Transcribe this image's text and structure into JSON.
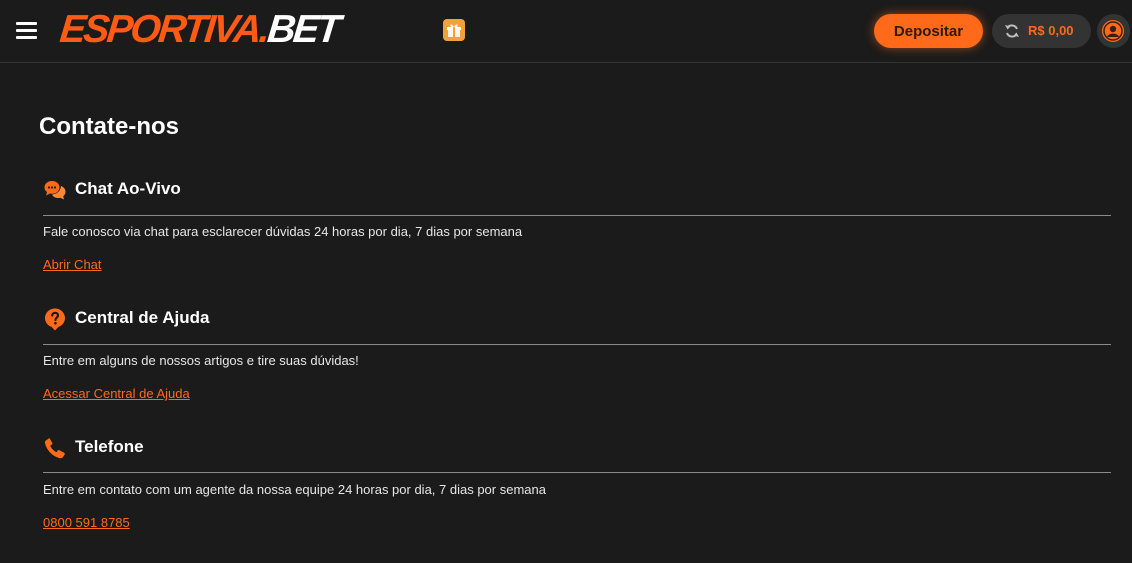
{
  "header": {
    "logo_part1": "ESPORTIVA",
    "logo_dot": ".",
    "logo_part2": "BET",
    "deposit_label": "Depositar",
    "balance": "R$ 0,00",
    "icons": {
      "menu": "hamburger-menu-icon",
      "gift": "gift-icon",
      "refresh": "refresh-icon",
      "avatar": "user-avatar-icon"
    },
    "colors": {
      "accent": "#ff6a1a",
      "gift": "#f2a23a"
    }
  },
  "main": {
    "title": "Contate-nos",
    "sections": [
      {
        "icon": "chat-bubbles-icon",
        "title": "Chat Ao-Vivo",
        "description": "Fale conosco via chat para esclarecer dúvidas 24 horas por dia, 7 dias por semana",
        "link": "Abrir Chat"
      },
      {
        "icon": "help-question-icon",
        "title": "Central de Ajuda",
        "description": "Entre em alguns de nossos artigos e tire suas dúvidas!",
        "link": "Acessar Central de Ajuda"
      },
      {
        "icon": "phone-icon",
        "title": "Telefone",
        "description": "Entre em contato com um agente da nossa equipe 24 horas por dia, 7 dias por semana",
        "link": "0800 591 8785"
      }
    ]
  },
  "colors": {
    "background": "#1b1b1b",
    "accent": "#ff6a1a",
    "divider": "#8a8a8a"
  }
}
